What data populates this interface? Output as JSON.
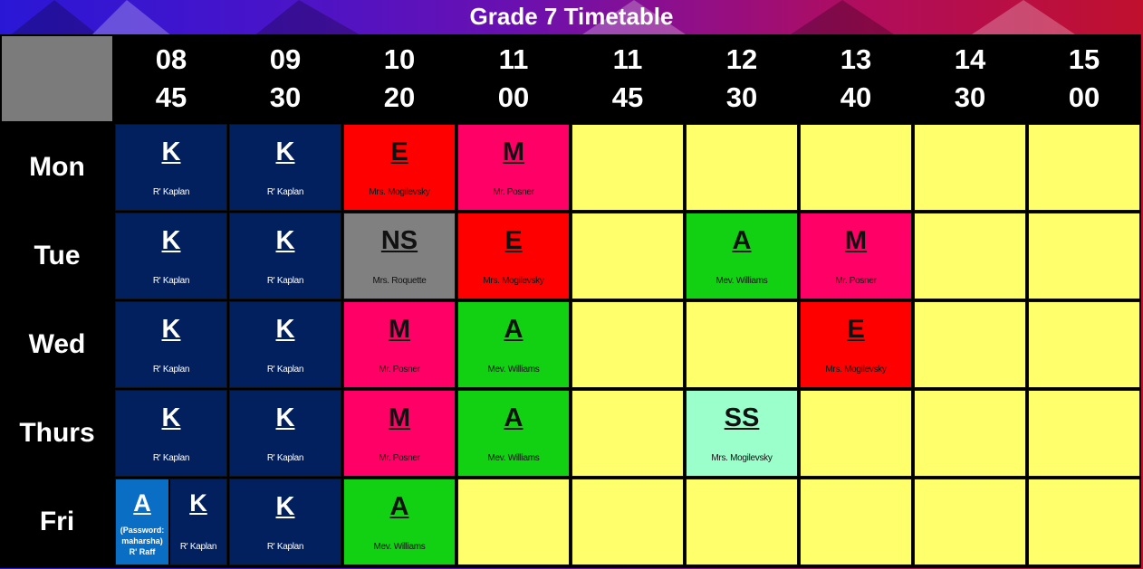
{
  "title": "Grade 7 Timetable",
  "colors": {
    "K": "#02205e",
    "E": "#ff0000",
    "M": "#ff0066",
    "NS": "#808080",
    "A": "#12d012",
    "SS": "#9bffcb",
    "A_fri": "#0a6fc4",
    "empty": "#ffff6b"
  },
  "times": [
    {
      "h": "08",
      "m": "45"
    },
    {
      "h": "09",
      "m": "30"
    },
    {
      "h": "10",
      "m": "20"
    },
    {
      "h": "11",
      "m": "00"
    },
    {
      "h": "11",
      "m": "45"
    },
    {
      "h": "12",
      "m": "30"
    },
    {
      "h": "13",
      "m": "40"
    },
    {
      "h": "14",
      "m": "30"
    },
    {
      "h": "15",
      "m": "00"
    }
  ],
  "days": [
    "Mon",
    "Tue",
    "Wed",
    "Thurs",
    "Fri"
  ],
  "schedule": {
    "Mon": [
      {
        "code": "K",
        "teacher": "R' Kaplan",
        "style": "K"
      },
      {
        "code": "K",
        "teacher": "R' Kaplan",
        "style": "K"
      },
      {
        "code": "E",
        "teacher": "Mrs. Mogilevsky",
        "style": "E"
      },
      {
        "code": "M",
        "teacher": "Mr. Posner",
        "style": "M"
      },
      null,
      null,
      null,
      null,
      null
    ],
    "Tue": [
      {
        "code": "K",
        "teacher": "R' Kaplan",
        "style": "K"
      },
      {
        "code": "K",
        "teacher": "R' Kaplan",
        "style": "K"
      },
      {
        "code": "NS",
        "teacher": "Mrs. Roquette",
        "style": "NS"
      },
      {
        "code": "E",
        "teacher": "Mrs. Mogilevsky",
        "style": "E"
      },
      null,
      {
        "code": "A",
        "teacher": "Mev. Williams",
        "style": "A"
      },
      {
        "code": "M",
        "teacher": "Mr. Posner",
        "style": "M"
      },
      null,
      null
    ],
    "Wed": [
      {
        "code": "K",
        "teacher": "R' Kaplan",
        "style": "K"
      },
      {
        "code": "K",
        "teacher": "R' Kaplan",
        "style": "K"
      },
      {
        "code": "M",
        "teacher": "Mr. Posner",
        "style": "M"
      },
      {
        "code": "A",
        "teacher": "Mev. Williams",
        "style": "A"
      },
      null,
      null,
      {
        "code": "E",
        "teacher": "Mrs. Mogilevsky",
        "style": "E"
      },
      null,
      null
    ],
    "Thurs": [
      {
        "code": "K",
        "teacher": "R' Kaplan",
        "style": "K"
      },
      {
        "code": "K",
        "teacher": "R' Kaplan",
        "style": "K"
      },
      {
        "code": "M",
        "teacher": "Mr. Posner",
        "style": "M"
      },
      {
        "code": "A",
        "teacher": "Mev. Williams",
        "style": "A"
      },
      null,
      {
        "code": "SS",
        "teacher": "Mrs. Mogilevsky",
        "style": "SS"
      },
      null,
      null,
      null
    ],
    "Fri": [
      {
        "split": [
          {
            "code": "A",
            "note": [
              "(Password:",
              "maharsha)",
              "R' Raff"
            ],
            "style": "A_fri"
          },
          {
            "code": "K",
            "teacher": "R' Kaplan",
            "style": "K"
          }
        ]
      },
      {
        "code": "K",
        "teacher": "R' Kaplan",
        "style": "K"
      },
      {
        "code": "A",
        "teacher": "Mev. Williams",
        "style": "A"
      },
      null,
      null,
      null,
      null,
      null,
      null
    ]
  }
}
